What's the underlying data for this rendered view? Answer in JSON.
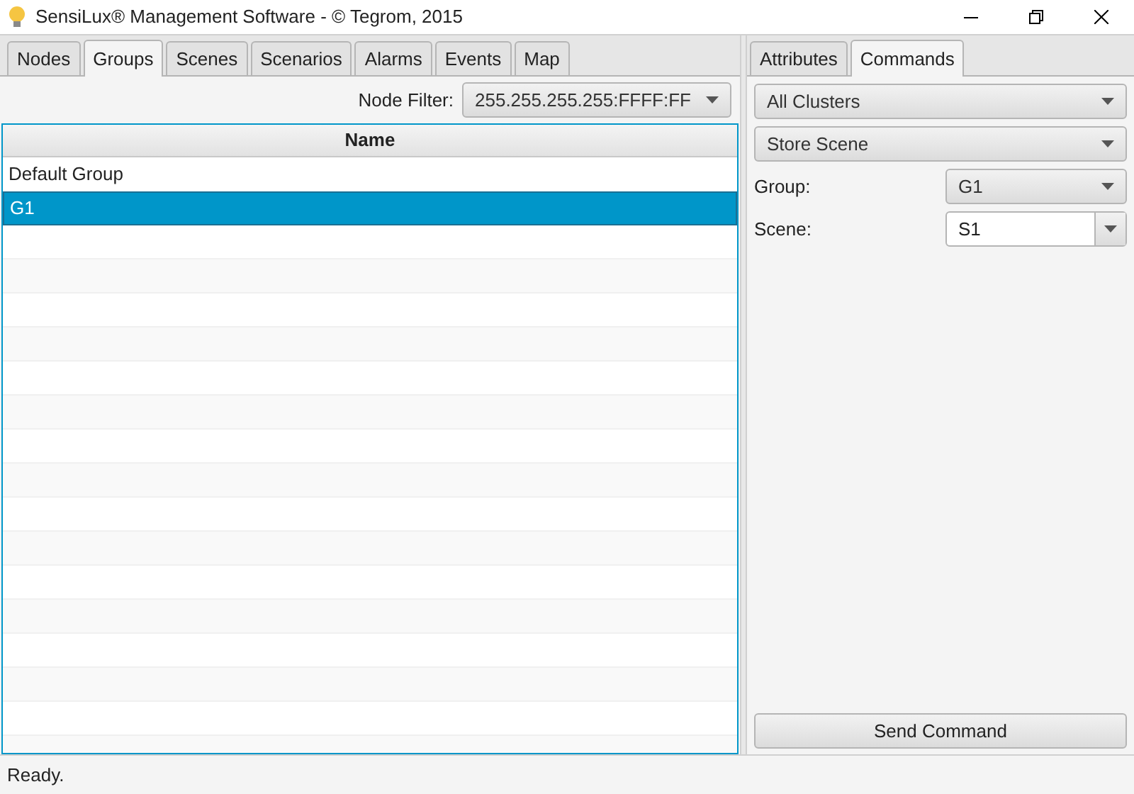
{
  "window": {
    "title": "SensiLux® Management Software - © Tegrom, 2015"
  },
  "left_tabs": [
    {
      "label": "Nodes",
      "selected": false
    },
    {
      "label": "Groups",
      "selected": true
    },
    {
      "label": "Scenes",
      "selected": false
    },
    {
      "label": "Scenarios",
      "selected": false
    },
    {
      "label": "Alarms",
      "selected": false
    },
    {
      "label": "Events",
      "selected": false
    },
    {
      "label": "Map",
      "selected": false
    }
  ],
  "node_filter": {
    "label": "Node Filter:",
    "value": "255.255.255.255:FFFF:FF"
  },
  "table": {
    "columns": [
      "Name"
    ],
    "rows": [
      {
        "name": "Default Group",
        "selected": false
      },
      {
        "name": "G1",
        "selected": true
      }
    ]
  },
  "right_tabs": [
    {
      "label": "Attributes",
      "selected": false
    },
    {
      "label": "Commands",
      "selected": true
    }
  ],
  "cluster_select": {
    "value": "All Clusters"
  },
  "command_select": {
    "value": "Store Scene"
  },
  "fields": [
    {
      "label": "Group:",
      "value": "G1",
      "kind": "select"
    },
    {
      "label": "Scene:",
      "value": "S1",
      "kind": "combo"
    }
  ],
  "send_button": "Send Command",
  "status_bar": "Ready."
}
